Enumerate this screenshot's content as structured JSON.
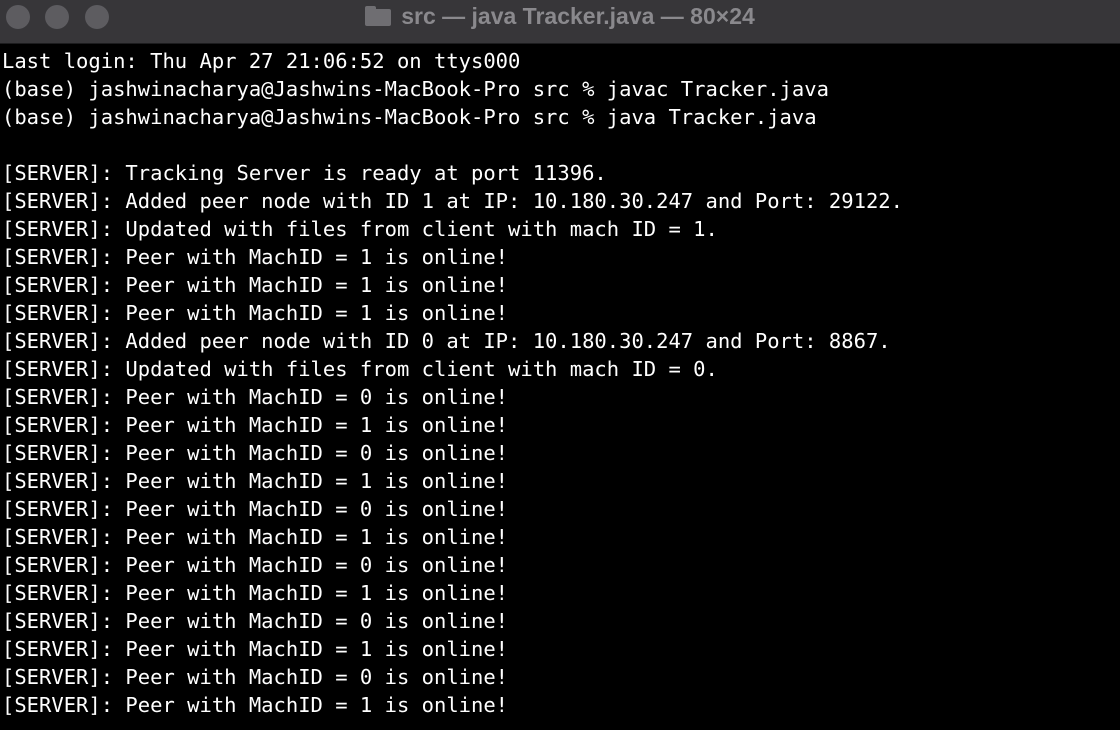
{
  "window": {
    "title": "src — java Tracker.java — 80×24",
    "folder_icon": "folder-icon"
  },
  "terminal": {
    "lines": [
      "Last login: Thu Apr 27 21:06:52 on ttys000",
      "(base) jashwinacharya@Jashwins-MacBook-Pro src % javac Tracker.java",
      "(base) jashwinacharya@Jashwins-MacBook-Pro src % java Tracker.java",
      "",
      "[SERVER]: Tracking Server is ready at port 11396.",
      "[SERVER]: Added peer node with ID 1 at IP: 10.180.30.247 and Port: 29122.",
      "[SERVER]: Updated with files from client with mach ID = 1.",
      "[SERVER]: Peer with MachID = 1 is online!",
      "[SERVER]: Peer with MachID = 1 is online!",
      "[SERVER]: Peer with MachID = 1 is online!",
      "[SERVER]: Added peer node with ID 0 at IP: 10.180.30.247 and Port: 8867.",
      "[SERVER]: Updated with files from client with mach ID = 0.",
      "[SERVER]: Peer with MachID = 0 is online!",
      "[SERVER]: Peer with MachID = 1 is online!",
      "[SERVER]: Peer with MachID = 0 is online!",
      "[SERVER]: Peer with MachID = 1 is online!",
      "[SERVER]: Peer with MachID = 0 is online!",
      "[SERVER]: Peer with MachID = 1 is online!",
      "[SERVER]: Peer with MachID = 0 is online!",
      "[SERVER]: Peer with MachID = 1 is online!",
      "[SERVER]: Peer with MachID = 0 is online!",
      "[SERVER]: Peer with MachID = 1 is online!",
      "[SERVER]: Peer with MachID = 0 is online!",
      "[SERVER]: Peer with MachID = 1 is online!"
    ]
  },
  "colors": {
    "background": "#000000",
    "text": "#ffffff",
    "titlebar": "#373639",
    "title_text": "#8a898d",
    "traffic_light_inactive": "#5d5c60"
  }
}
